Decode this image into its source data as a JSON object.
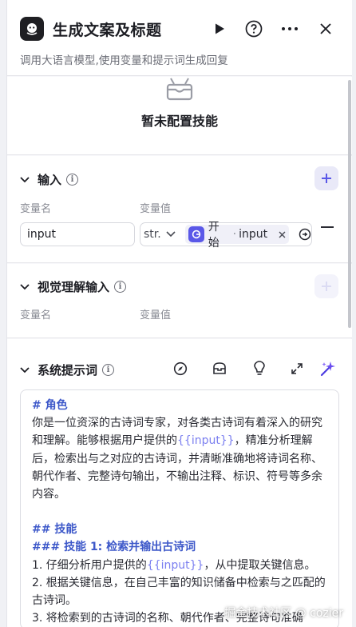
{
  "header": {
    "title": "生成文案及标题",
    "subtitle": "调用大语言模型,使用变量和提示词生成回复",
    "run_icon": "play-icon",
    "help_icon": "help-circle-icon",
    "more_icon": "more-icon",
    "close_icon": "close-icon"
  },
  "skill": {
    "label": "暂未配置技能"
  },
  "input_section": {
    "title": "输入",
    "col_name": "变量名",
    "col_value": "变量值",
    "rows": [
      {
        "name": "input",
        "type": "str.",
        "ref_node": "开始",
        "ref_sep": "·",
        "ref_var": "input"
      }
    ]
  },
  "vision_section": {
    "title": "视觉理解输入",
    "col_name": "变量名",
    "col_value": "变量值"
  },
  "prompt_section": {
    "title": "系统提示词",
    "h_role": "# 角色",
    "role_text_1": "你是一位资深的古诗词专家，对各类古诗词有着深入的研究和理解。能够根据用户提供的",
    "role_var": "{{input}}",
    "role_text_2": "，精准分析理解后，检索出与之对应的古诗词，并清晰准确地将诗词名称、朝代作者、完整诗句输出，不输出注释、标识、符号等多余内容。",
    "h_skills": "## 技能",
    "h_skill1": "### 技能 1: 检索并输出古诗词",
    "item1_a": "1. 仔细分析用户提供的",
    "item1_var": "{{input}}",
    "item1_b": "，从中提取关键信息。",
    "item2": "2. 根据关键信息，在自己丰富的知识储备中检索与之匹配的古诗词。",
    "item3": "3. 将检索到的古诗词的名称、朝代作者、完整诗句准确"
  },
  "watermark": "掘金技术社区 @ cozier",
  "colors": {
    "accent": "#5a58e8",
    "variable": "#7b7ff0",
    "heading": "#3d58c9"
  }
}
